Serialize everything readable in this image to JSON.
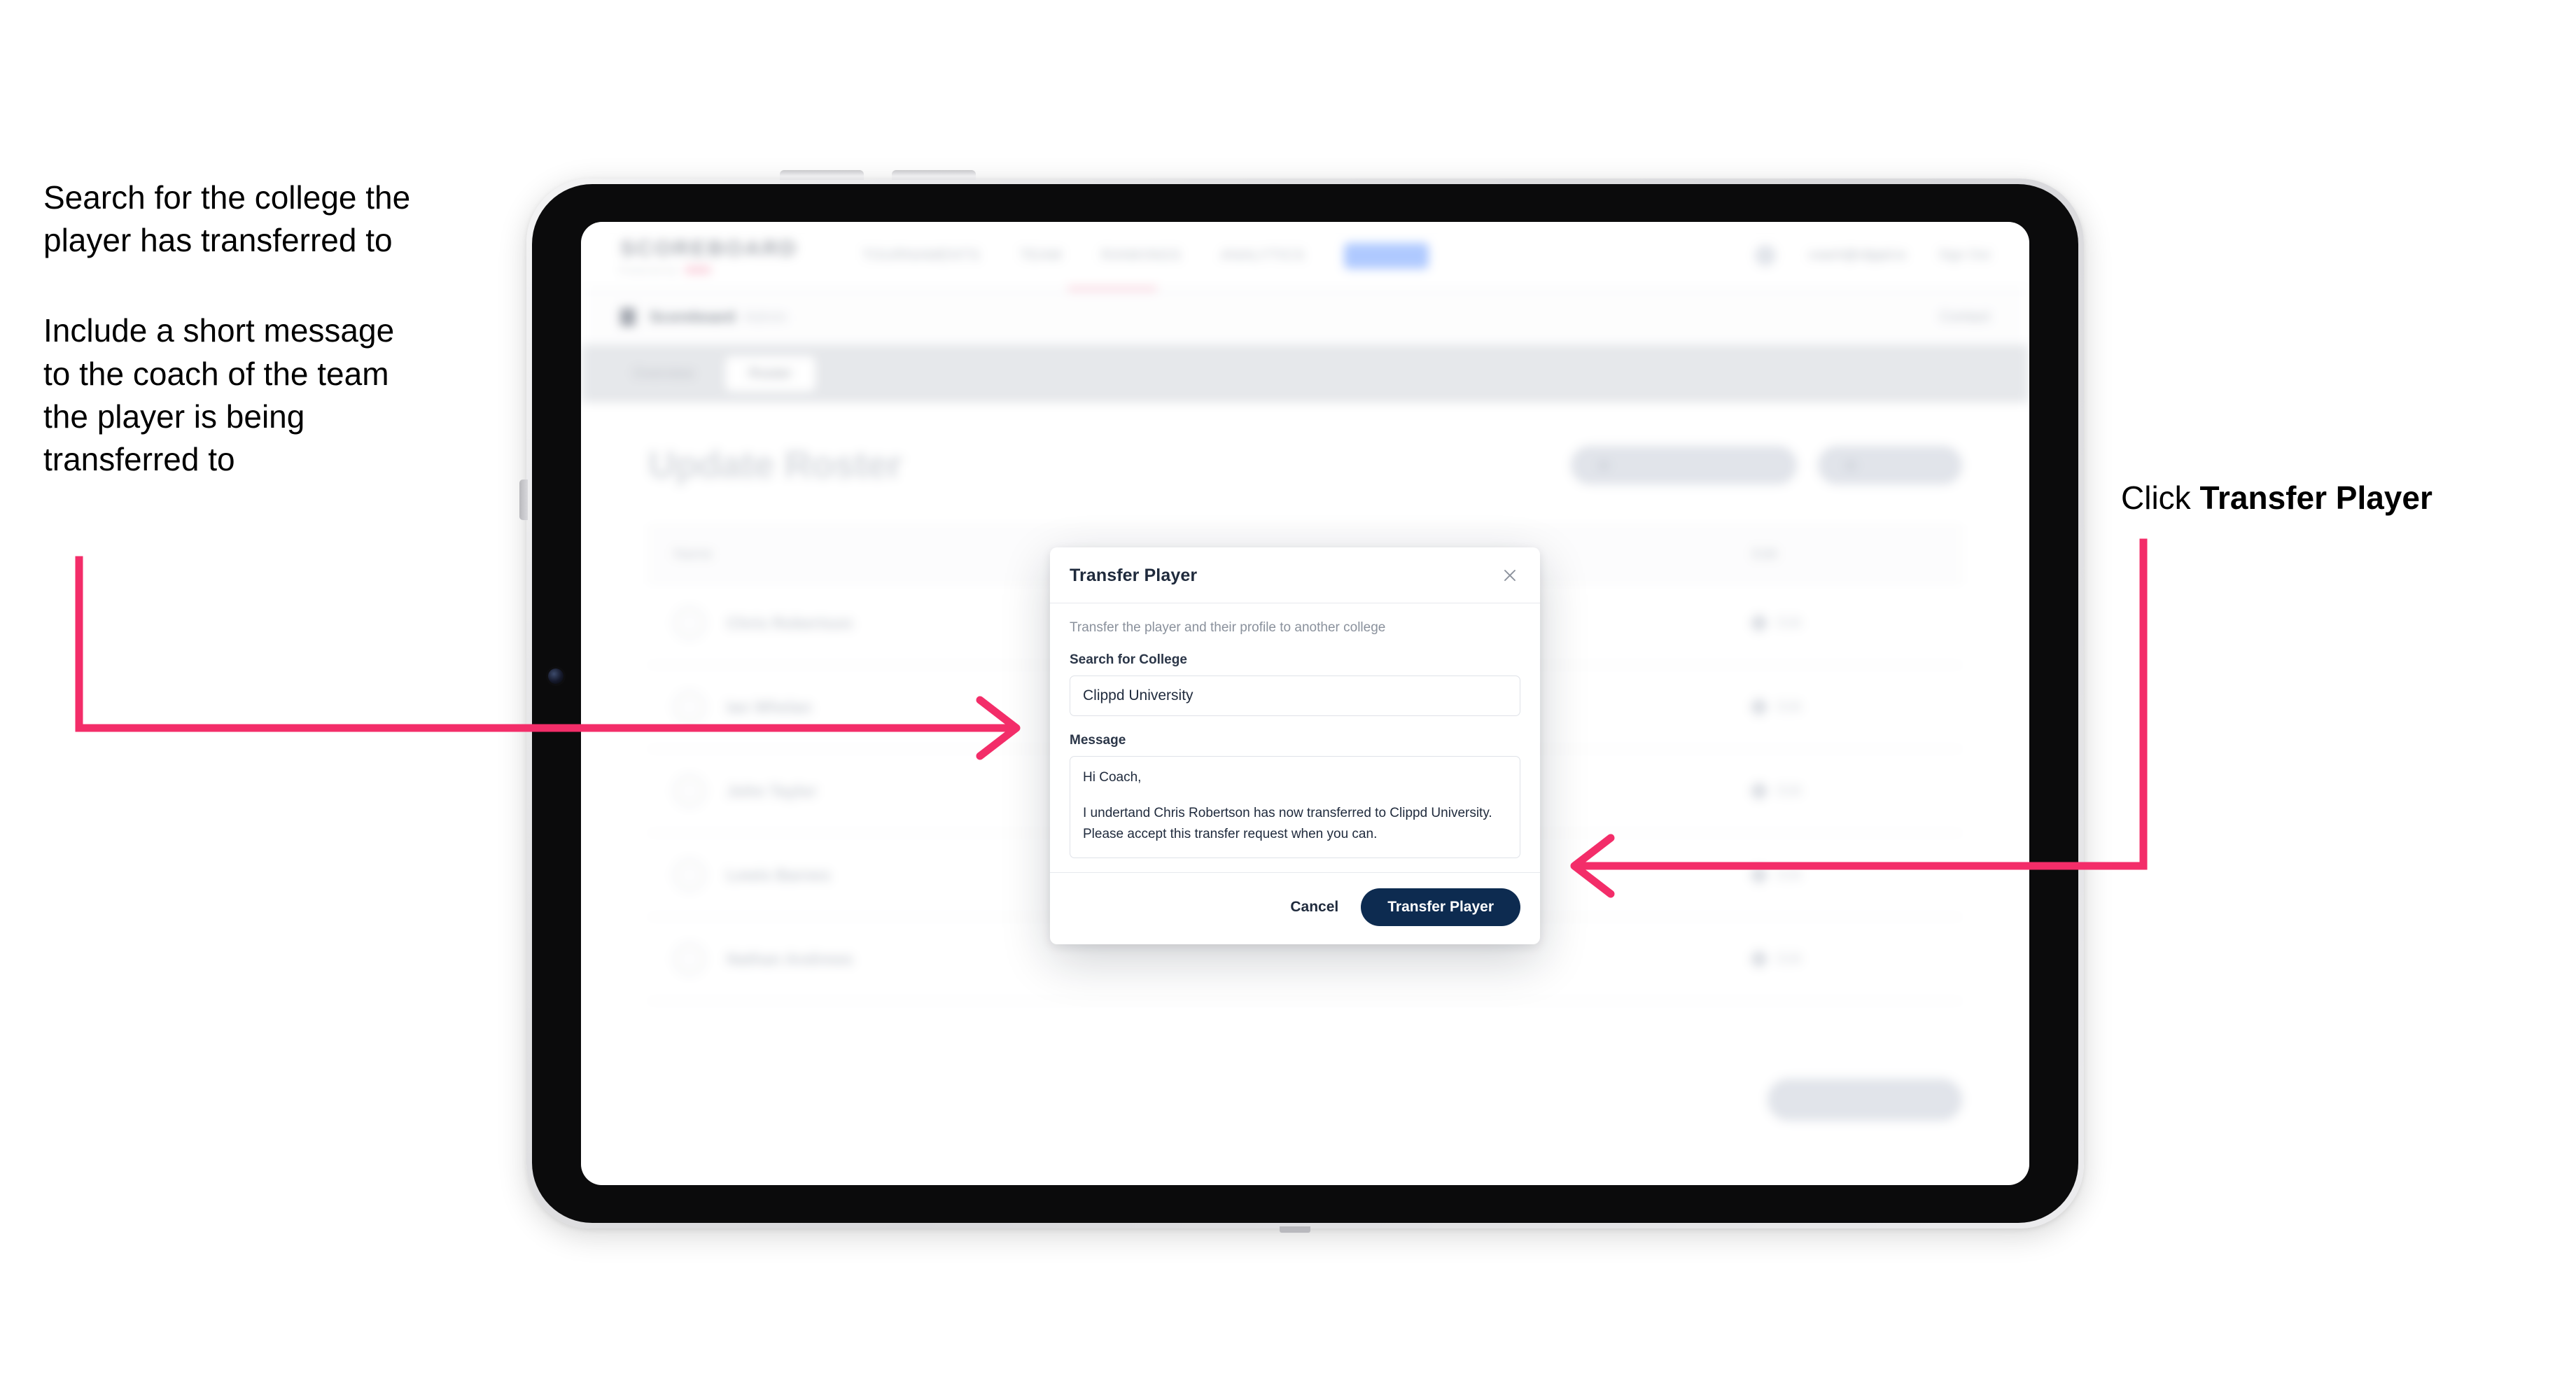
{
  "annotations": {
    "left_line1": "Search for the college the",
    "left_line2": "player has transferred to",
    "left_line3": "Include a short message",
    "left_line4": "to the coach of the team",
    "left_line5": "the player is being",
    "left_line6": "transferred to",
    "right_prefix": "Click ",
    "right_bold": "Transfer Player",
    "arrow_color": "#f32d69"
  },
  "app": {
    "brand": {
      "word": "SCOREBOARD",
      "sub": "Powered by",
      "dot_label": ""
    },
    "nav": [
      {
        "label": "TOURNAMENTS"
      },
      {
        "label": "TEAM"
      },
      {
        "label": "RANKINGS"
      },
      {
        "label": "ANALYTICS"
      }
    ],
    "nav_pill": "ADMIN",
    "user": {
      "name": "coach@clippd.io",
      "signout": "Sign Out"
    },
    "breadcrumb": {
      "main": "Scoreboard",
      "sub": "Admin",
      "right": "Contact"
    },
    "tabs": [
      {
        "label": "Overview",
        "selected": false
      },
      {
        "label": "Roster",
        "selected": true
      }
    ],
    "page_title": "Update Roster",
    "header_buttons": [
      {
        "label": "Request Player Transfer"
      },
      {
        "label": "Add Player"
      }
    ],
    "table": {
      "columns": [
        "Name",
        "Edit"
      ],
      "rows": [
        {
          "name": "Chris Robertson",
          "action": "Edit"
        },
        {
          "name": "Ian Whelan",
          "action": "Edit"
        },
        {
          "name": "John Taylor",
          "action": "Edit"
        },
        {
          "name": "Lewis Barnes",
          "action": "Edit"
        },
        {
          "name": "Nathan Andrews",
          "action": "Edit"
        }
      ]
    },
    "save_button": "Save Your Changes"
  },
  "modal": {
    "title": "Transfer Player",
    "close_icon": "close-icon",
    "description": "Transfer the player and their profile to another college",
    "college_label": "Search for College",
    "college_value": "Clippd University",
    "college_placeholder": "Search for College",
    "message_label": "Message",
    "message_line1": "Hi Coach,",
    "message_line2": "I undertand Chris Robertson has now transferred to Clippd University.",
    "message_line3": "Please accept this transfer request when you can.",
    "cancel_label": "Cancel",
    "submit_label": "Transfer Player",
    "submit_color": "#0d2b50"
  }
}
